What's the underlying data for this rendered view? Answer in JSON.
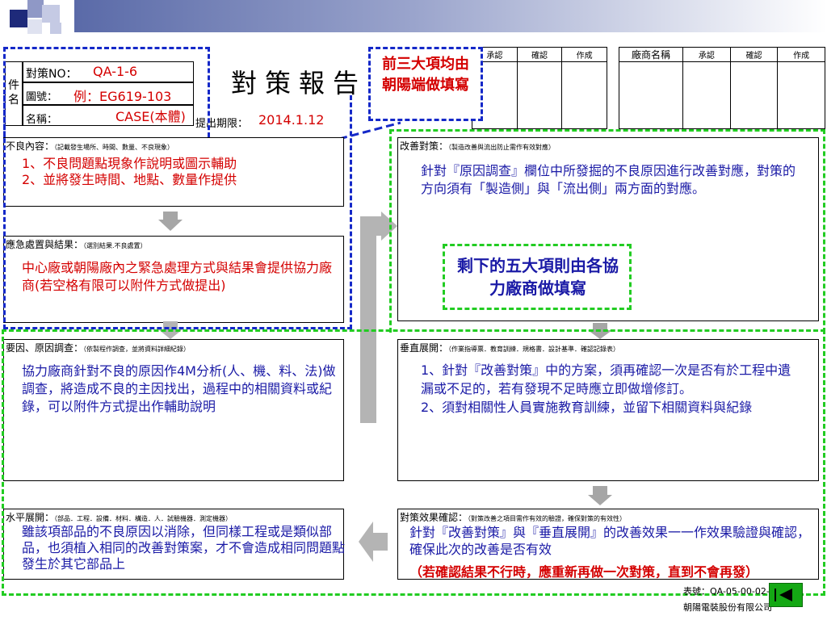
{
  "header": {
    "measure_no_label": "對策NO：",
    "measure_no_value": "QA-1-6",
    "part_label": "件名",
    "drawing_label": "圖號：",
    "drawing_value": "例：EG619-103",
    "name_label": "名稱：",
    "name_value": "CASE(本體)",
    "title": "對策報告",
    "due_label": "提出期限：",
    "due_value": "2014.1.12",
    "callout_top": "前三大項均由朝陽端做填寫",
    "approval_cols": [
      "承認",
      "確認",
      "作成"
    ],
    "vendor_label": "廠商名稱",
    "vendor_cols": [
      "承認",
      "確認",
      "作成"
    ]
  },
  "sections": {
    "defect": {
      "title": "不良內容：",
      "hint": "（記載發生場所、時間、數量、不良現象）",
      "lines": [
        "1、不良問題點現象作說明或圖示輔助",
        "2、並將發生時間、地點、數量作提供"
      ]
    },
    "emergency": {
      "title": "應急處置與結果：",
      "hint": "（選別結果.不良處置）",
      "text": "中心廠或朝陽廠內之緊急處理方式與結果會提供協力廠商(若空格有限可以附件方式做提出)"
    },
    "cause": {
      "title": "要因、原因調查：",
      "hint": "（依製程作調查，並將資料詳細紀錄）",
      "text": "協力廠商針對不良的原因作4M分析(人、機、料、法)做調查，將造成不良的主因找出，過程中的相關資料或紀錄，可以附件方式提出作輔助說明"
    },
    "horizontal": {
      "title": "水平展開：",
      "hint": "（部品．工程．設備．材料．構造．人．試驗機器．測定機器）",
      "text": "雖該項部品的不良原因以消除，但同樣工程或是類似部品，也須植入相同的改善對策案，才不會造成相同問題點發生於其它部品上"
    },
    "improve": {
      "title": "改善對策：",
      "hint": "（製造改善與流出防止需作有效對應）",
      "text": "針對『原因調查』欄位中所發掘的不良原因進行改善對應，對策的方向須有「製造側」與「流出側」兩方面的對應。"
    },
    "vertical": {
      "title": "垂直展開：",
      "hint": "（作業指導票．教育訓練．規格書．設計基準．確認記錄表）",
      "lines": [
        "1、針對『改善對策』中的方案，須再確認一次是否有於工程中遺漏或不足的，若有發現不足時應立即做增修訂。",
        "2、須對相關性人員實施教育訓練，並留下相關資料與紀錄"
      ]
    },
    "effect": {
      "title": "對策效果確認：",
      "hint": "（對策改善之項目需作有效的驗證，確保對策的有效性）",
      "text": "針對『改善對策』與『垂直展開』的改善效果一一作效果驗證與確認，確保此次的改善是否有效",
      "warning": "（若確認結果不行時，應重新再做一次對策，直到不會再發）"
    }
  },
  "callout_green": "剩下的五大項則由各協力廠商做填寫",
  "footer": {
    "form_no": "表號：QA-05-00-02-0",
    "company": "朝陽電裝股份有限公司"
  },
  "colors": {
    "blue_dash": "#1428c8",
    "green_dash": "#22cc22",
    "red_text": "#d40000",
    "blue_text": "#1a1aa6"
  },
  "icons": {
    "nav_back": "back-triangle-icon"
  }
}
